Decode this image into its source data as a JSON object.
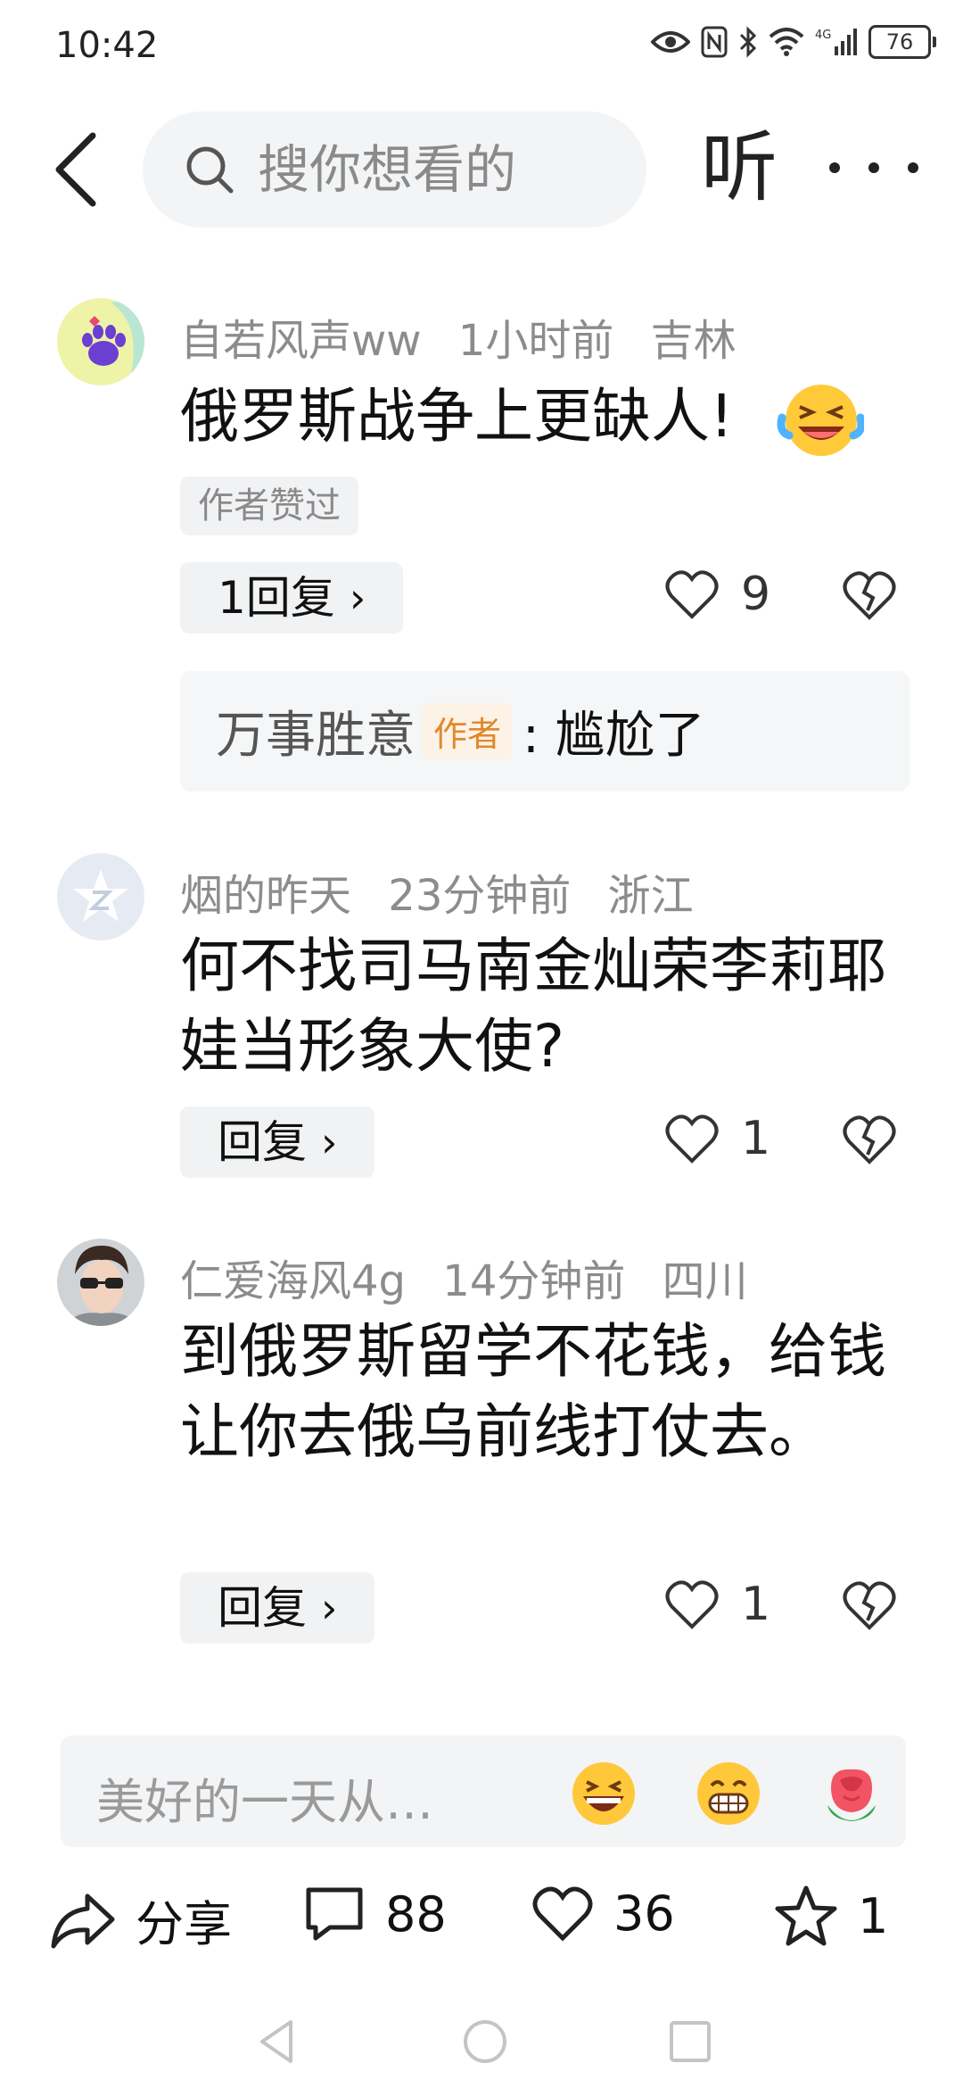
{
  "status_bar": {
    "time": "10:42",
    "battery": "76"
  },
  "top_bar": {
    "search_placeholder": "搜你想看的",
    "listen_label": "听"
  },
  "comments": [
    {
      "username": "自若风声ww",
      "time_ago": "1小时前",
      "location": "吉林",
      "text": "俄罗斯战争上更缺人!",
      "badge": "作者赞过",
      "reply_label": "1回复",
      "likes": "9",
      "reply": {
        "user": "万事胜意",
        "author_tag": "作者",
        "text": ": 尴尬了"
      }
    },
    {
      "username": "烟的昨天",
      "time_ago": "23分钟前",
      "location": "浙江",
      "text": "何不找司马南金灿荣李莉耶娃当形象大使?",
      "reply_label": "回复",
      "likes": "1"
    },
    {
      "username": "仁爱海风4g",
      "time_ago": "14分钟前",
      "location": "四川",
      "text": "到俄罗斯留学不花钱，给钱让你去俄乌前线打仗去。",
      "reply_label": "回复",
      "likes": "1"
    }
  ],
  "input_bar": {
    "placeholder": "美好的一天从…"
  },
  "bottom_bar": {
    "share_label": "分享",
    "comments_count": "88",
    "likes_count": "36",
    "favorites_count": "1"
  }
}
